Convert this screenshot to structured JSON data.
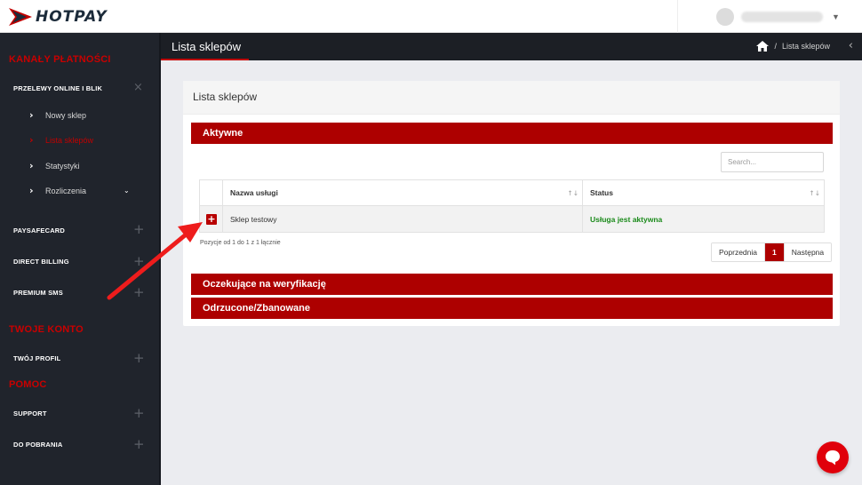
{
  "brand": {
    "name": "HOTPAY",
    "accent": "#c20000",
    "dark": "#20242c"
  },
  "sidebar": {
    "sections": {
      "channels": "KANAŁY PŁATNOŚCI",
      "account": "TWOJE KONTO",
      "help": "POMOC"
    },
    "items": {
      "przelewy": "PRZELEWY ONLINE I BLIK",
      "paysafecard": "PAYSAFECARD",
      "direct_billing": "DIRECT BILLING",
      "premium_sms": "PREMIUM SMS",
      "profil": "TWÓJ PROFIL",
      "support": "SUPPORT",
      "downloads": "DO POBRANIA"
    },
    "sub": {
      "new_shop": "Nowy sklep",
      "shop_list": "Lista sklepów",
      "stats": "Statystyki",
      "settlements": "Rozliczenia"
    }
  },
  "header": {
    "page_title": "Lista sklepów",
    "breadcrumb_sep": "/",
    "breadcrumb_current": "Lista sklepów"
  },
  "card": {
    "title": "Lista sklepów",
    "active_label": "Aktywne",
    "pending_label": "Oczekujące na weryfikację",
    "rejected_label": "Odrzucone/Zbanowane",
    "search_placeholder": "Search...",
    "columns": {
      "name": "Nazwa usługi",
      "status": "Status"
    },
    "rows": [
      {
        "expand": "+",
        "name": "Sklep testowy",
        "status": "Usługa jest aktywna"
      }
    ],
    "info": "Pozycje od 1 do 1 z 1 łącznie",
    "pager": {
      "prev": "Poprzednia",
      "current": "1",
      "next": "Następna"
    }
  },
  "icons": {
    "home": "home-icon",
    "chat": "chat-icon",
    "arrow": "annotation-arrow"
  }
}
